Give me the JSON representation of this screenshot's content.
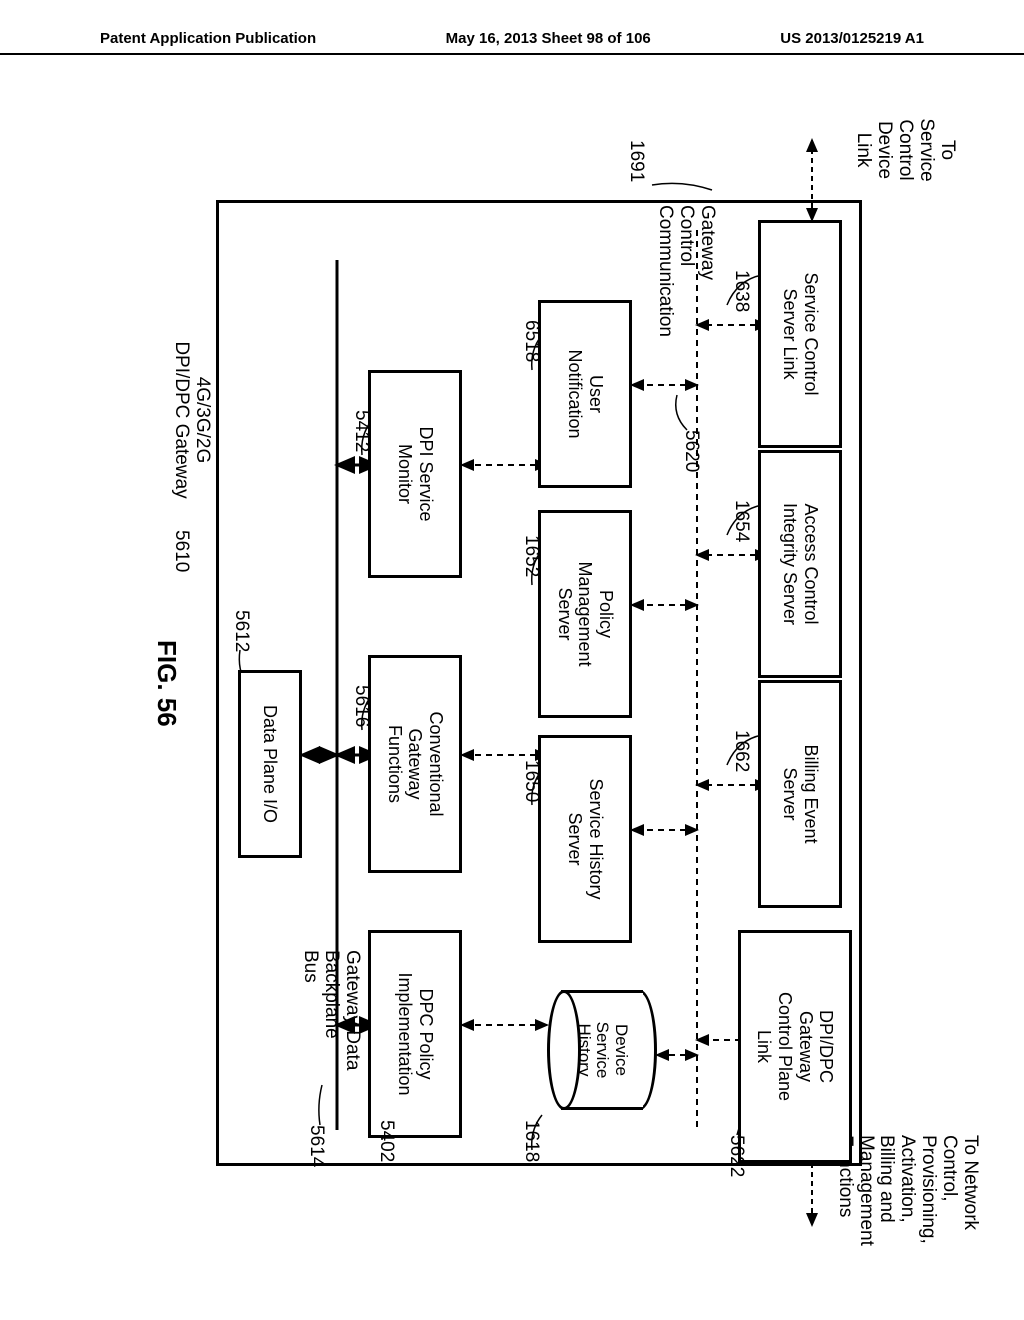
{
  "header": {
    "left": "Patent Application Publication",
    "center": "May 16, 2013  Sheet 98 of 106",
    "right": "US 2013/0125219 A1"
  },
  "ext": {
    "left": "To\nService\nControl\nDevice\nLink",
    "right": "To Network\nControl,\nProvisioning,\nActivation,\nBilling and\nManagement\nFunctions"
  },
  "boxes": {
    "service_control_server_link": "Service Control\nServer Link",
    "access_control_integrity": "Access Control\nIntegrity Server",
    "billing_event_server": "Billing Event\nServer",
    "dpi_dpc_gateway_cpl": "DPI/DPC\nGateway\nControl Plane\nLink",
    "user_notification": "User\nNotification",
    "policy_management_server": "Policy\nManagement\nServer",
    "service_history_server": "Service History\nServer",
    "device_service_history": "Device\nService\nHistory",
    "dpi_service_monitor": "DPI Service\nMonitor",
    "conventional_gateway_functions": "Conventional\nGateway\nFunctions",
    "dpc_policy_implementation": "DPC Policy\nImplementation",
    "data_plane_io": "Data Plane I/O"
  },
  "bus_labels": {
    "control_bus": "Gateway\nControl\nCommunication",
    "data_bus": "Gateway Data\nBackplane\nBus"
  },
  "numbers": {
    "n1691": "1691",
    "n1638": "1638",
    "n1654": "1654",
    "n1662": "1662",
    "n5622": "5622",
    "n5620": "5620",
    "n6518": "6518",
    "n1652": "1652",
    "n1650": "1650",
    "n1618": "1618",
    "n5412": "5412",
    "n5616": "5616",
    "n5402": "5402",
    "n5614": "5614",
    "n5612": "5612",
    "n5610": "5610"
  },
  "caption": {
    "gateway_label": "4G/3G/2G\nDPI/DPC Gateway",
    "figure": "FIG. 56"
  }
}
